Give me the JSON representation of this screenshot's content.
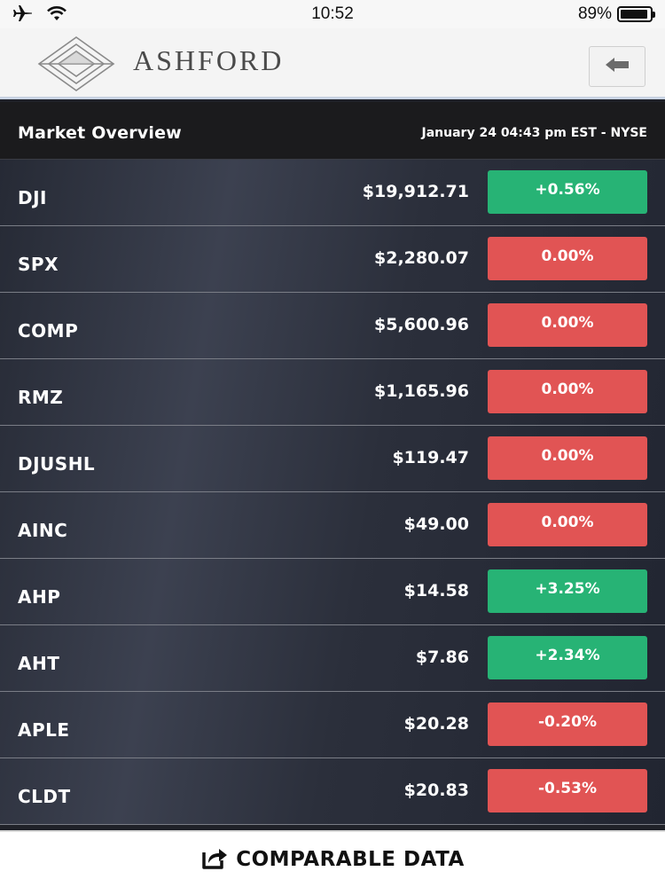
{
  "status_bar": {
    "time": "10:52",
    "battery_text": "89%",
    "battery_level": 0.89,
    "airplane_icon": "airplane-icon",
    "wifi_icon": "wifi-icon"
  },
  "header": {
    "brand": "ASHFORD",
    "back_icon": "back-arrow-icon"
  },
  "market": {
    "title": "Market Overview",
    "date": "January 24 04:43 pm EST - NYSE"
  },
  "colors": {
    "positive": "#27b375",
    "negative": "#e15454"
  },
  "quotes": [
    {
      "symbol": "DJI",
      "price": "$19,912.71",
      "change": "+0.56%",
      "direction": "up"
    },
    {
      "symbol": "SPX",
      "price": "$2,280.07",
      "change": "0.00%",
      "direction": "down"
    },
    {
      "symbol": "COMP",
      "price": "$5,600.96",
      "change": "0.00%",
      "direction": "down"
    },
    {
      "symbol": "RMZ",
      "price": "$1,165.96",
      "change": "0.00%",
      "direction": "down"
    },
    {
      "symbol": "DJUSHL",
      "price": "$119.47",
      "change": "0.00%",
      "direction": "down"
    },
    {
      "symbol": "AINC",
      "price": "$49.00",
      "change": "0.00%",
      "direction": "down"
    },
    {
      "symbol": "AHP",
      "price": "$14.58",
      "change": "+3.25%",
      "direction": "up"
    },
    {
      "symbol": "AHT",
      "price": "$7.86",
      "change": "+2.34%",
      "direction": "up"
    },
    {
      "symbol": "APLE",
      "price": "$20.28",
      "change": "-0.20%",
      "direction": "down"
    },
    {
      "symbol": "CLDT",
      "price": "$20.83",
      "change": "-0.53%",
      "direction": "down"
    }
  ],
  "footer": {
    "button_label": "COMPARABLE DATA",
    "icon": "share-icon"
  }
}
